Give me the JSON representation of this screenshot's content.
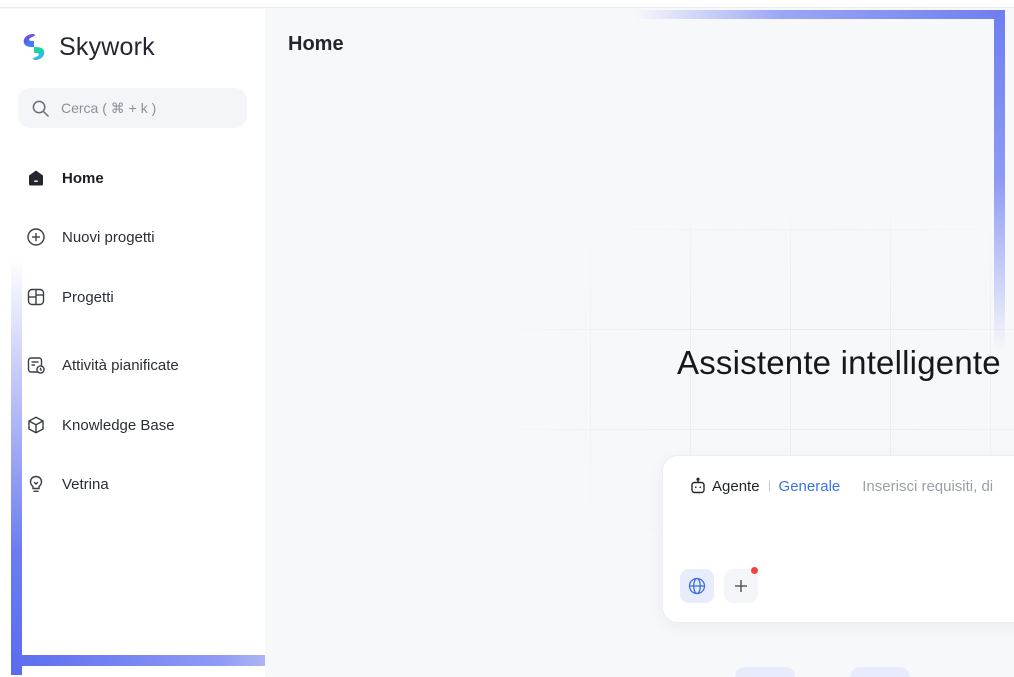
{
  "app": {
    "name": "Skywork"
  },
  "search": {
    "label": "Cerca ( ⌘ + k )",
    "icon": "search-icon"
  },
  "sidebar": {
    "items": [
      {
        "label": "Home",
        "icon": "home-icon",
        "active": true
      },
      {
        "label": "Nuovi progetti",
        "icon": "plus-circle-icon"
      },
      {
        "label": "Progetti",
        "icon": "projects-grid-icon"
      },
      {
        "label": "Attività pianificate",
        "icon": "calendar-clock-icon"
      },
      {
        "label": "Knowledge Base",
        "icon": "cube-icon"
      },
      {
        "label": "Vetrina",
        "icon": "lightbulb-icon"
      }
    ]
  },
  "main": {
    "page_title": "Home",
    "hero_title": "Assistente intelligente",
    "prompt": {
      "mode_agent": "Agente",
      "mode_general": "Generale",
      "placeholder": "Inserisci requisiti, di"
    }
  },
  "colors": {
    "accent": "#3b74e8",
    "frame_gradient": "#6e7ef0",
    "notification_dot": "#f0433a"
  }
}
